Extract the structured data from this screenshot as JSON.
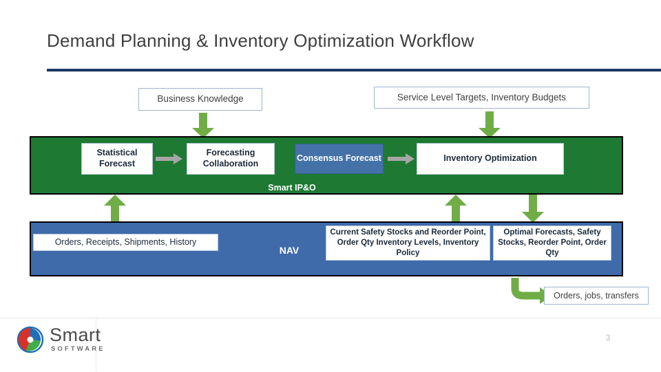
{
  "slide": {
    "title": "Demand Planning & Inventory Optimization Workflow",
    "page_number": "3"
  },
  "colors": {
    "title_text": "#3f3f3f",
    "title_rule": "#1f3864",
    "green_band": "#1e7a32",
    "blue_band": "#3f6bab",
    "consensus_box": "#4472a8",
    "green_arrow": "#70ad47",
    "gray_arrow": "#a6a6a6",
    "box_border": "#9fb4d0"
  },
  "callouts": {
    "business_knowledge": "Business Knowledge",
    "service_level": "Service Level Targets, Inventory Budgets",
    "orders_jobs_transfers": "Orders, jobs, transfers"
  },
  "green_band": {
    "label": "Smart IP&O",
    "boxes": [
      {
        "label": "Statistical Forecast"
      },
      {
        "label": "Forecasting Collaboration"
      },
      {
        "label": "Consensus Forecast"
      },
      {
        "label": "Inventory Optimization"
      }
    ]
  },
  "blue_band": {
    "nav_label": "NAV",
    "boxes": [
      {
        "label": "Orders, Receipts, Shipments, History"
      },
      {
        "label": "Current Safety Stocks and Reorder Point, Order Qty Inventory Levels, Inventory Policy"
      },
      {
        "label": "Optimal Forecasts, Safety Stocks, Reorder Point, Order Qty"
      }
    ]
  },
  "logo": {
    "name": "Smart",
    "subtitle": "SOFTWARE"
  },
  "icons": {
    "arrow_down_business": "arrow-down-icon",
    "arrow_down_service": "arrow-down-icon",
    "arrow_right_stat_to_forecast": "arrow-right-icon",
    "arrow_right_consensus_to_inventory": "arrow-right-icon",
    "arrow_up_orders": "arrow-up-icon",
    "arrow_up_current": "arrow-up-icon",
    "arrow_down_optimal": "arrow-down-icon",
    "arrow_curved_orders_jobs": "curved-arrow-right-icon",
    "logo_mark": "smart-software-logo-icon"
  }
}
